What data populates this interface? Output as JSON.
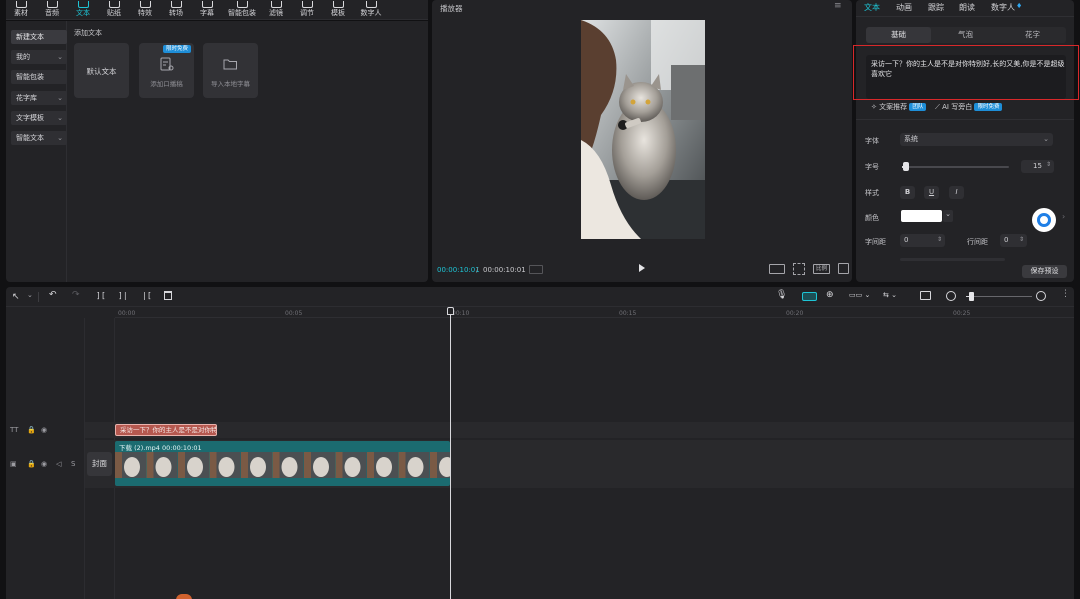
{
  "toolbar": {
    "items": [
      {
        "label": "素材",
        "icon": "media-icon"
      },
      {
        "label": "音频",
        "icon": "audio-icon"
      },
      {
        "label": "文本",
        "icon": "text-icon",
        "active": true
      },
      {
        "label": "贴纸",
        "icon": "sticker-icon"
      },
      {
        "label": "特效",
        "icon": "effects-icon"
      },
      {
        "label": "转场",
        "icon": "transition-icon"
      },
      {
        "label": "字幕",
        "icon": "subtitle-icon"
      },
      {
        "label": "智能包装",
        "icon": "smart-package-icon"
      },
      {
        "label": "滤镜",
        "icon": "filter-icon"
      },
      {
        "label": "调节",
        "icon": "adjust-icon"
      },
      {
        "label": "模板",
        "icon": "template-icon"
      },
      {
        "label": "数字人",
        "icon": "digital-human-icon"
      }
    ]
  },
  "left_nav": {
    "items": [
      {
        "label": "新建文本",
        "active": true
      },
      {
        "label": "我的",
        "chevron": true
      },
      {
        "label": "智能包装"
      },
      {
        "label": "花字库",
        "chevron": true
      },
      {
        "label": "文字模板",
        "chevron": true
      },
      {
        "label": "智能文本",
        "chevron": true
      }
    ]
  },
  "text_panel": {
    "section_title": "添加文本",
    "default_text": "默认文本",
    "add_script": "添加口播稿",
    "import_subtitle": "导入本地字幕",
    "badge": "限时免费"
  },
  "player": {
    "title": "播放器",
    "current_time": "00:00:10:01",
    "total_time": "00:00:10:01",
    "ratio_label": "比例"
  },
  "properties": {
    "tabs": [
      "文本",
      "动画",
      "跟踪",
      "朗读",
      "数字人"
    ],
    "active_tab": "文本",
    "subtabs": [
      "基础",
      "气泡",
      "花字"
    ],
    "text_content": "采访一下？你的主人是不是对你特别好,长的又美,你是不是超级喜欢它",
    "copy_recommend": "文案推荐",
    "copy_badge": "团队",
    "ai_write": "AI 写旁白",
    "ai_badge": "限时免费",
    "font_label": "字体",
    "font_value": "系统",
    "size_label": "字号",
    "size_value": "15",
    "size_level": 0.02,
    "style_label": "样式",
    "style_bold": "B",
    "style_underline": "U",
    "style_italic": "I",
    "color_label": "颜色",
    "color_value": "#ffffff",
    "letter_spacing_label": "字间距",
    "letter_spacing_value": "0",
    "line_spacing_label": "行间距",
    "line_spacing_value": "0",
    "save_preset": "保存预设"
  },
  "timeline": {
    "ticks": [
      "00:00",
      "00:05",
      "00:10",
      "00:15",
      "00:20",
      "00:25"
    ],
    "text_clip": "采访一下？你的主人是不是对你特",
    "video_clip_label": "下载 (2).mp4  00:00:10:01",
    "cover_label": "封面",
    "text_track_icon": "TT",
    "zoom_level": 0.06
  }
}
